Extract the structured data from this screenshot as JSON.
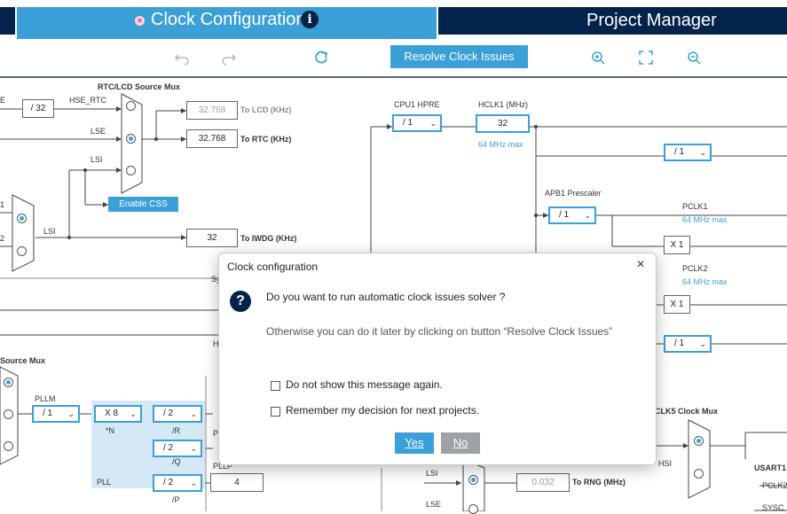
{
  "tabs": {
    "clock": "Clock Configuration",
    "project": "Project Manager",
    "close_glyph": "×",
    "info_glyph": "i"
  },
  "toolbar": {
    "resolve": "Resolve Clock Issues",
    "undo_icon": "undo-icon",
    "redo_icon": "redo-icon",
    "refresh_icon": "refresh-icon",
    "zoom_in_icon": "zoom-in-icon",
    "fit_icon": "fit-icon",
    "zoom_out_icon": "zoom-out-icon"
  },
  "diagram": {
    "rtc_mux_title": "RTC/LCD Source Mux",
    "e_left": "E",
    "div32": "/ 32",
    "hse_rtc": "HSE_RTC",
    "lse": "LSE",
    "lsi": "LSI",
    "lcd_val": "32.768",
    "to_lcd": "To LCD (KHz)",
    "rtc_val": "32.768",
    "to_rtc": "To RTC (KHz)",
    "enable_css": "Enable CSS",
    "lsi2": "LSI",
    "iwdg_val": "32",
    "to_iwdg": "To IWDG (KHz)",
    "one": "1",
    "two": "2",
    "sy": "Sy",
    "cpu1_hpre": "CPU1 HPRE",
    "cpu1_sel": "/ 1",
    "hclk1_label": "HCLK1 (MHz)",
    "hclk1_val": "32",
    "hclk1_max": "64 MHz max",
    "div1_a": "/ 1",
    "apb1_presc": "APB1 Prescaler",
    "apb1_sel": "/ 1",
    "pclk1": "PCLK1",
    "pclk1_max": "64 MHz max",
    "x1_a": "X 1",
    "pclk2": "PCLK2",
    "pclk2_max": "64 MHz max",
    "x1_b": "X 1",
    "div1_b": "/ 1",
    "h_left": "H",
    "source_mux": "Source Mux",
    "pllm": "PLLM",
    "pllm_sel": "/ 1",
    "n_sel": "X 8",
    "n_label": "*N",
    "r_sel": "/ 2",
    "r_label": "/R",
    "q_sel": "/ 2",
    "q_label": "/Q",
    "p_sel": "/ 2",
    "p_label": "/P",
    "pll": "PLL",
    "p_left": "P",
    "pllp": "PLLP",
    "pllp_val": "4",
    "lsi3": "LSI",
    "lse2": "LSE",
    "rng_val": "0.032",
    "to_rng": "To RNG (MHz)",
    "clk5_mux": "CLK5 Clock Mux",
    "hsi": "HSI",
    "usart1": "USART1",
    "pclk2b": "PCLK2",
    "sysc": "SYSC"
  },
  "dialog": {
    "title": "Clock configuration",
    "close": "×",
    "q_glyph": "?",
    "message": "Do you want to run automatic clock issues solver ?",
    "message2": "Otherwise you can do it later by clicking on button “Resolve Clock Issues”",
    "check1": "Do not show this message again.",
    "check2": "Remember my decision for next projects.",
    "yes": "Yes",
    "no": "No"
  },
  "colors": {
    "accent": "#3b9fd8",
    "dark": "#03234b"
  }
}
